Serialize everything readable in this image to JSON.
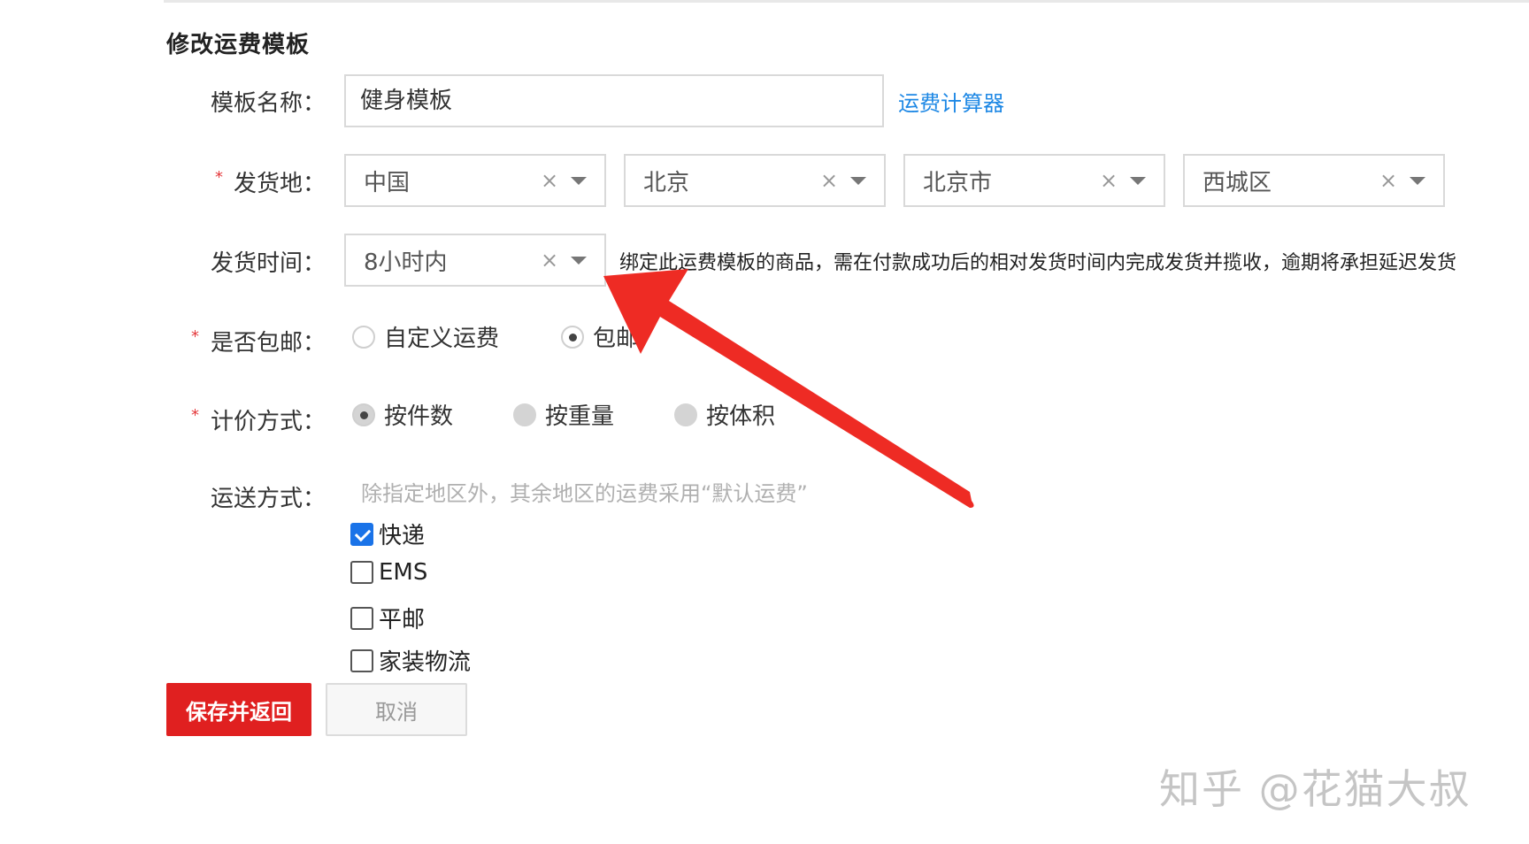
{
  "page": {
    "title": "修改运费模板"
  },
  "template_name": {
    "label": "模板名称：",
    "value": "健身模板",
    "calculator_link": "运费计算器"
  },
  "ship_from": {
    "required_mark": "*",
    "label": "发货地：",
    "clear_glyph": "×",
    "selects": [
      "中国",
      "北京",
      "北京市",
      "西城区"
    ]
  },
  "ship_time": {
    "label": "发货时间：",
    "value": "8小时内",
    "clear_glyph": "×",
    "hint": "绑定此运费模板的商品，需在付款成功后的相对发货时间内完成发货并揽收，逾期将承担延迟发货"
  },
  "free_shipping": {
    "required_mark": "*",
    "label": "是否包邮：",
    "options": [
      {
        "label": "自定义运费",
        "checked": false
      },
      {
        "label": "包邮",
        "checked": true
      }
    ]
  },
  "pricing": {
    "required_mark": "*",
    "label": "计价方式：",
    "options": [
      {
        "label": "按件数",
        "checked": true
      },
      {
        "label": "按重量",
        "checked": false
      },
      {
        "label": "按体积",
        "checked": false
      }
    ]
  },
  "delivery": {
    "label": "运送方式：",
    "hint": "除指定地区外，其余地区的运费采用“默认运费”",
    "options": [
      {
        "label": "快递",
        "checked": true
      },
      {
        "label": "EMS",
        "checked": false
      },
      {
        "label": "平邮",
        "checked": false
      },
      {
        "label": "家装物流",
        "checked": false
      }
    ]
  },
  "actions": {
    "save_label": "保存并返回",
    "cancel_label": "取消"
  },
  "watermark": "知乎 @花猫大叔",
  "colors": {
    "save_button": "#e02020",
    "link": "#1e88e5",
    "annotation_arrow": "#ee2b24",
    "checkbox_checked": "#1a73e8"
  }
}
